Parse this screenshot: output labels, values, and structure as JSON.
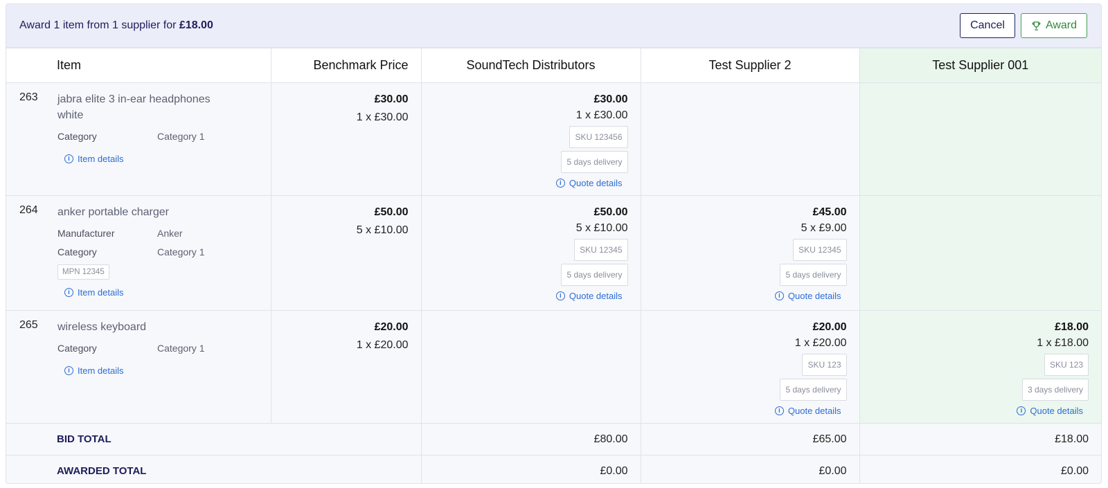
{
  "summary": {
    "prefix": "Award 1 item from 1 supplier for ",
    "amount": "£18.00"
  },
  "buttons": {
    "cancel": "Cancel",
    "award": "Award"
  },
  "headers": {
    "item": "Item",
    "benchmark": "Benchmark Price",
    "sup1": "SoundTech Distributors",
    "sup2": "Test Supplier 2",
    "sup3": "Test Supplier 001"
  },
  "item_details_label": "Item details",
  "quote_details_label": "Quote details",
  "rows": [
    {
      "num": "263",
      "name": "jabra elite 3 in-ear headphones white",
      "attr_category_key": "Category",
      "attr_category_val": "Category 1",
      "bench_total": "£30.00",
      "bench_unit": "1 x £30.00",
      "sup1": {
        "total": "£30.00",
        "unit": "1 x £30.00",
        "sku": "SKU 123456",
        "delivery": "5 days delivery"
      }
    },
    {
      "num": "264",
      "name": "anker portable charger",
      "attr_manufacturer_key": "Manufacturer",
      "attr_manufacturer_val": "Anker",
      "attr_category_key": "Category",
      "attr_category_val": "Category 1",
      "mpn": "MPN 12345",
      "bench_total": "£50.00",
      "bench_unit": "5 x £10.00",
      "sup1": {
        "total": "£50.00",
        "unit": "5 x £10.00",
        "sku": "SKU 12345",
        "delivery": "5 days delivery"
      },
      "sup2": {
        "total": "£45.00",
        "unit": "5 x £9.00",
        "sku": "SKU 12345",
        "delivery": "5 days delivery"
      }
    },
    {
      "num": "265",
      "name": "wireless keyboard",
      "attr_category_key": "Category",
      "attr_category_val": "Category 1",
      "bench_total": "£20.00",
      "bench_unit": "1 x £20.00",
      "sup2": {
        "total": "£20.00",
        "unit": "1 x £20.00",
        "sku": "SKU 123",
        "delivery": "5 days delivery"
      },
      "sup3": {
        "total": "£18.00",
        "unit": "1 x £18.00",
        "sku": "SKU 123",
        "delivery": "3 days delivery"
      }
    }
  ],
  "totals": {
    "bid_label": "BID TOTAL",
    "bid": [
      "£80.00",
      "£65.00",
      "£18.00"
    ],
    "awarded_label": "AWARDED TOTAL",
    "awarded": [
      "£0.00",
      "£0.00",
      "£0.00"
    ]
  },
  "colors": {
    "header_bg": "#ebedf9",
    "awarded_bg": "#ecf7ef",
    "link": "#2b6cd6",
    "award_green": "#2f8a3c",
    "navy": "#1e1e5a"
  }
}
